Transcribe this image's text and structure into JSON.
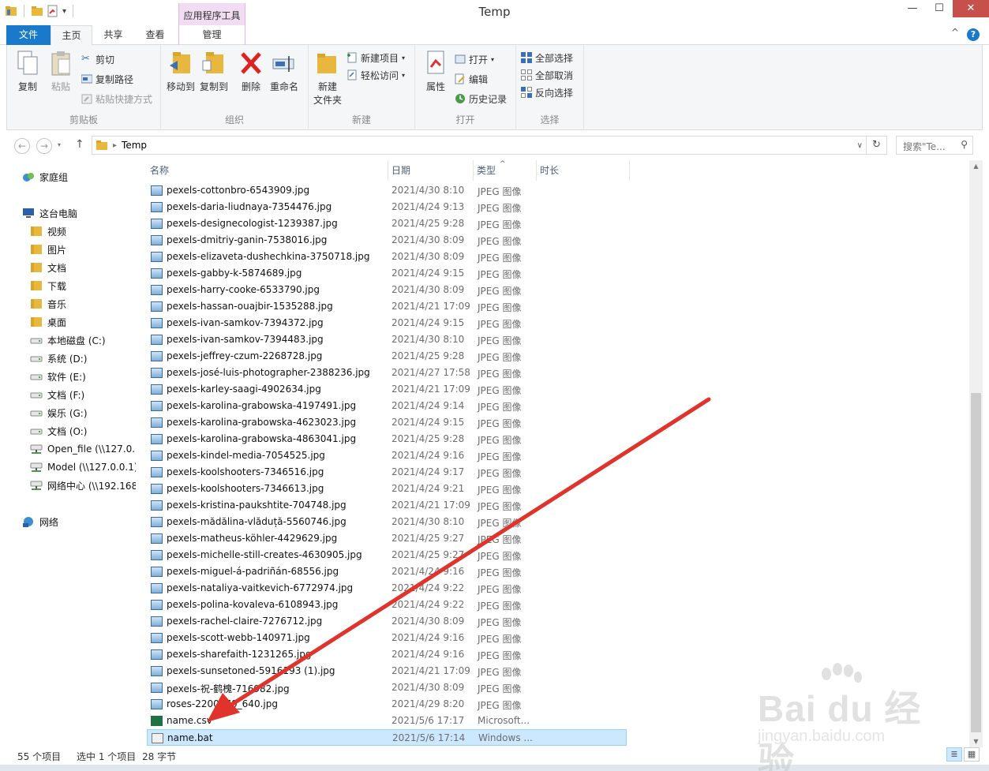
{
  "window": {
    "title": "Temp",
    "context_tab_header": "应用程序工具",
    "controls": {
      "minimize": "—",
      "maximize": "☐",
      "close": "✕"
    }
  },
  "tabs": [
    {
      "label": "文件"
    },
    {
      "label": "主页"
    },
    {
      "label": "共享"
    },
    {
      "label": "查看"
    },
    {
      "label": "管理"
    }
  ],
  "help_label": "?",
  "collapse_label": "^",
  "ribbon": {
    "clipboard": {
      "group_label": "剪贴板",
      "copy": "复制",
      "paste": "粘贴",
      "cut": "剪切",
      "copy_path": "复制路径",
      "paste_shortcut": "粘贴快捷方式"
    },
    "organize": {
      "group_label": "组织",
      "move_to": "移动到",
      "copy_to": "复制到",
      "delete": "删除",
      "rename": "重命名"
    },
    "new": {
      "group_label": "新建",
      "new_folder_line1": "新建",
      "new_folder_line2": "文件夹",
      "new_item": "新建项目",
      "easy_access": "轻松访问"
    },
    "open": {
      "group_label": "打开",
      "properties": "属性",
      "open": "打开",
      "edit": "编辑",
      "history": "历史记录"
    },
    "select": {
      "group_label": "选择",
      "select_all": "全部选择",
      "select_none": "全部取消",
      "invert": "反向选择"
    }
  },
  "address": {
    "path": "Temp",
    "back": "←",
    "forward": "→",
    "up": "↑",
    "refresh": "↻",
    "dropdown": "∨",
    "search_placeholder": "搜索\"Te...",
    "search_icon": "⚲"
  },
  "nav": {
    "homegroup": "家庭组",
    "this_pc": "这台电脑",
    "items": [
      {
        "label": "视频",
        "icon": "folder-icon"
      },
      {
        "label": "图片",
        "icon": "folder-icon"
      },
      {
        "label": "文档",
        "icon": "folder-icon"
      },
      {
        "label": "下载",
        "icon": "folder-icon"
      },
      {
        "label": "音乐",
        "icon": "folder-icon"
      },
      {
        "label": "桌面",
        "icon": "folder-icon"
      },
      {
        "label": "本地磁盘 (C:)",
        "icon": "drive-icon"
      },
      {
        "label": "系统 (D:)",
        "icon": "drive-icon"
      },
      {
        "label": "软件 (E:)",
        "icon": "drive-icon"
      },
      {
        "label": "文档 (F:)",
        "icon": "drive-icon"
      },
      {
        "label": "娱乐 (G:)",
        "icon": "drive-icon"
      },
      {
        "label": "文档 (O:)",
        "icon": "drive-icon"
      },
      {
        "label": "Open_file (\\\\127.0.0",
        "icon": "network-drive-icon"
      },
      {
        "label": "Model (\\\\127.0.0.1)",
        "icon": "network-drive-icon"
      },
      {
        "label": "网络中心 (\\\\192.168",
        "icon": "network-drive-icon"
      }
    ],
    "network": "网络"
  },
  "columns": {
    "name": "名称",
    "date": "日期",
    "type": "类型",
    "duration": "时长",
    "sort_indicator": "^"
  },
  "files": [
    {
      "name": "pexels-cottonbro-6543909.jpg",
      "date": "2021/4/30 8:10",
      "type": "JPEG 图像",
      "kind": "jpg"
    },
    {
      "name": "pexels-daria-liudnaya-7354476.jpg",
      "date": "2021/4/24 9:13",
      "type": "JPEG 图像",
      "kind": "jpg"
    },
    {
      "name": "pexels-designecologist-1239387.jpg",
      "date": "2021/4/25 9:28",
      "type": "JPEG 图像",
      "kind": "jpg"
    },
    {
      "name": "pexels-dmitriy-ganin-7538016.jpg",
      "date": "2021/4/30 8:09",
      "type": "JPEG 图像",
      "kind": "jpg"
    },
    {
      "name": "pexels-elizaveta-dushechkina-3750718.jpg",
      "date": "2021/4/30 8:09",
      "type": "JPEG 图像",
      "kind": "jpg"
    },
    {
      "name": "pexels-gabby-k-5874689.jpg",
      "date": "2021/4/24 9:15",
      "type": "JPEG 图像",
      "kind": "jpg"
    },
    {
      "name": "pexels-harry-cooke-6533790.jpg",
      "date": "2021/4/30 8:09",
      "type": "JPEG 图像",
      "kind": "jpg"
    },
    {
      "name": "pexels-hassan-ouajbir-1535288.jpg",
      "date": "2021/4/21 17:09",
      "type": "JPEG 图像",
      "kind": "jpg"
    },
    {
      "name": "pexels-ivan-samkov-7394372.jpg",
      "date": "2021/4/24 9:15",
      "type": "JPEG 图像",
      "kind": "jpg"
    },
    {
      "name": "pexels-ivan-samkov-7394483.jpg",
      "date": "2021/4/30 8:10",
      "type": "JPEG 图像",
      "kind": "jpg"
    },
    {
      "name": "pexels-jeffrey-czum-2268728.jpg",
      "date": "2021/4/25 9:28",
      "type": "JPEG 图像",
      "kind": "jpg"
    },
    {
      "name": "pexels-josé-luis-photographer-2388236.jpg",
      "date": "2021/4/27 17:58",
      "type": "JPEG 图像",
      "kind": "jpg"
    },
    {
      "name": "pexels-karley-saagi-4902634.jpg",
      "date": "2021/4/21 17:09",
      "type": "JPEG 图像",
      "kind": "jpg"
    },
    {
      "name": "pexels-karolina-grabowska-4197491.jpg",
      "date": "2021/4/24 9:14",
      "type": "JPEG 图像",
      "kind": "jpg"
    },
    {
      "name": "pexels-karolina-grabowska-4623023.jpg",
      "date": "2021/4/24 9:15",
      "type": "JPEG 图像",
      "kind": "jpg"
    },
    {
      "name": "pexels-karolina-grabowska-4863041.jpg",
      "date": "2021/4/25 9:28",
      "type": "JPEG 图像",
      "kind": "jpg"
    },
    {
      "name": "pexels-kindel-media-7054525.jpg",
      "date": "2021/4/24 9:16",
      "type": "JPEG 图像",
      "kind": "jpg"
    },
    {
      "name": "pexels-koolshooters-7346516.jpg",
      "date": "2021/4/24 9:17",
      "type": "JPEG 图像",
      "kind": "jpg"
    },
    {
      "name": "pexels-koolshooters-7346613.jpg",
      "date": "2021/4/24 9:21",
      "type": "JPEG 图像",
      "kind": "jpg"
    },
    {
      "name": "pexels-kristina-paukshtite-704748.jpg",
      "date": "2021/4/21 17:09",
      "type": "JPEG 图像",
      "kind": "jpg"
    },
    {
      "name": "pexels-mădălina-vlăduță-5560746.jpg",
      "date": "2021/4/30 8:10",
      "type": "JPEG 图像",
      "kind": "jpg"
    },
    {
      "name": "pexels-matheus-köhler-4429629.jpg",
      "date": "2021/4/25 9:27",
      "type": "JPEG 图像",
      "kind": "jpg"
    },
    {
      "name": "pexels-michelle-still-creates-4630905.jpg",
      "date": "2021/4/25 9:27",
      "type": "JPEG 图像",
      "kind": "jpg"
    },
    {
      "name": "pexels-miguel-á-padriñán-68556.jpg",
      "date": "2021/4/24 9:16",
      "type": "JPEG 图像",
      "kind": "jpg"
    },
    {
      "name": "pexels-nataliya-vaitkevich-6772974.jpg",
      "date": "2021/4/24 9:22",
      "type": "JPEG 图像",
      "kind": "jpg"
    },
    {
      "name": "pexels-polina-kovaleva-6108943.jpg",
      "date": "2021/4/24 9:22",
      "type": "JPEG 图像",
      "kind": "jpg"
    },
    {
      "name": "pexels-rachel-claire-7276712.jpg",
      "date": "2021/4/30 8:09",
      "type": "JPEG 图像",
      "kind": "jpg"
    },
    {
      "name": "pexels-scott-webb-140971.jpg",
      "date": "2021/4/24 9:16",
      "type": "JPEG 图像",
      "kind": "jpg"
    },
    {
      "name": "pexels-sharefaith-1231265.jpg",
      "date": "2021/4/24 9:16",
      "type": "JPEG 图像",
      "kind": "jpg"
    },
    {
      "name": "pexels-sunsetoned-5916193 (1).jpg",
      "date": "2021/4/21 17:09",
      "type": "JPEG 图像",
      "kind": "jpg"
    },
    {
      "name": "pexels-祝-鹤槐-716982.jpg",
      "date": "2021/4/30 8:09",
      "type": "JPEG 图像",
      "kind": "jpg"
    },
    {
      "name": "roses-2200970_640.jpg",
      "date": "2021/4/29 8:20",
      "type": "JPEG 图像",
      "kind": "jpg"
    },
    {
      "name": "name.csv",
      "date": "2021/5/6 17:17",
      "type": "Microsoft...",
      "kind": "csv"
    },
    {
      "name": "name.bat",
      "date": "2021/5/6 17:14",
      "type": "Windows ...",
      "kind": "bat",
      "selected": true
    }
  ],
  "status": {
    "count": "55 个项目",
    "selection": "选中 1 个项目",
    "size": "28 字节",
    "details_view_icon": "≣",
    "large_icons_icon": "▦"
  },
  "watermark": {
    "text": "Bai du 经验",
    "url": "jingyan.baidu.com"
  },
  "colors": {
    "accent": "#1979ca",
    "selection": "#cce8ff",
    "context_tab": "#f2dcf2",
    "arrow": "#e0332b",
    "close_button": "#c7504b"
  }
}
